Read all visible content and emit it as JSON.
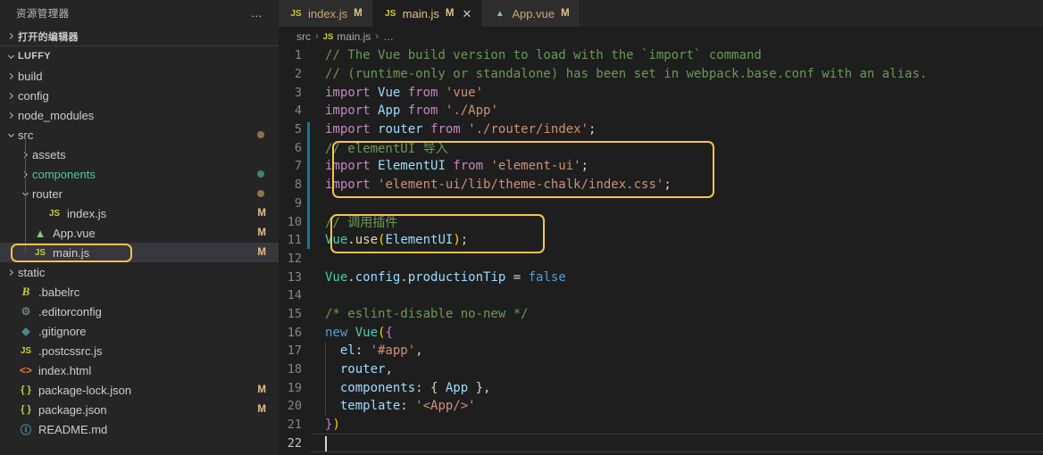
{
  "sidebar": {
    "header_title": "资源管理器",
    "more_icon": "…",
    "open_editors_label": "打开的编辑器",
    "project_label": "LUFFY",
    "tree": [
      {
        "name": "build",
        "kind": "folder",
        "icon": "chevron-right-icon",
        "indent": 1,
        "badge": "",
        "dot": "",
        "color": ""
      },
      {
        "name": "config",
        "kind": "folder",
        "icon": "chevron-right-icon",
        "indent": 1,
        "badge": "",
        "dot": "",
        "color": ""
      },
      {
        "name": "node_modules",
        "kind": "folder",
        "icon": "chevron-right-icon",
        "indent": 1,
        "badge": "",
        "dot": "",
        "color": ""
      },
      {
        "name": "src",
        "kind": "folder",
        "icon": "chevron-down-icon",
        "indent": 1,
        "badge": "",
        "dot": "#8c7349",
        "color": ""
      },
      {
        "name": "assets",
        "kind": "folder",
        "icon": "chevron-right-icon",
        "indent": 2,
        "badge": "",
        "dot": "",
        "color": ""
      },
      {
        "name": "components",
        "kind": "folder",
        "icon": "chevron-right-icon",
        "indent": 2,
        "badge": "",
        "dot": "#3a8a63",
        "color": "green"
      },
      {
        "name": "router",
        "kind": "folder",
        "icon": "chevron-down-icon",
        "indent": 2,
        "badge": "",
        "dot": "#8c7349",
        "color": ""
      },
      {
        "name": "index.js",
        "kind": "js",
        "icon": "js-file-icon",
        "indent": 3,
        "badge": "M",
        "dot": "",
        "color": ""
      },
      {
        "name": "App.vue",
        "kind": "vue",
        "icon": "vue-file-icon",
        "indent": 2,
        "badge": "M",
        "dot": "",
        "color": ""
      },
      {
        "name": "main.js",
        "kind": "js",
        "icon": "js-file-icon",
        "indent": 2,
        "badge": "M",
        "dot": "",
        "color": "",
        "selected": true,
        "annotated": true
      },
      {
        "name": "static",
        "kind": "folder",
        "icon": "chevron-right-icon",
        "indent": 1,
        "badge": "",
        "dot": "",
        "color": ""
      },
      {
        "name": ".babelrc",
        "kind": "babel",
        "icon": "babel-file-icon",
        "indent": 1,
        "badge": "",
        "dot": "",
        "color": ""
      },
      {
        "name": ".editorconfig",
        "kind": "gear",
        "icon": "gear-file-icon",
        "indent": 1,
        "badge": "",
        "dot": "",
        "color": ""
      },
      {
        "name": ".gitignore",
        "kind": "git",
        "icon": "git-file-icon",
        "indent": 1,
        "badge": "",
        "dot": "",
        "color": ""
      },
      {
        "name": ".postcssrc.js",
        "kind": "js",
        "icon": "js-file-icon",
        "indent": 1,
        "badge": "",
        "dot": "",
        "color": ""
      },
      {
        "name": "index.html",
        "kind": "html",
        "icon": "html-file-icon",
        "indent": 1,
        "badge": "",
        "dot": "",
        "color": ""
      },
      {
        "name": "package-lock.json",
        "kind": "json",
        "icon": "json-file-icon",
        "indent": 1,
        "badge": "M",
        "dot": "",
        "color": ""
      },
      {
        "name": "package.json",
        "kind": "json",
        "icon": "json-file-icon",
        "indent": 1,
        "badge": "M",
        "dot": "",
        "color": ""
      },
      {
        "name": "README.md",
        "kind": "md",
        "icon": "info-file-icon",
        "indent": 1,
        "badge": "",
        "dot": "",
        "color": ""
      }
    ]
  },
  "tabs": [
    {
      "icon": "js-file-icon",
      "name": "index.js",
      "dirty": "M",
      "active": false,
      "closable": false
    },
    {
      "icon": "js-file-icon",
      "name": "main.js",
      "dirty": "M",
      "active": true,
      "closable": true,
      "close_icon": "close-icon"
    },
    {
      "icon": "vue-file-icon",
      "name": "App.vue",
      "dirty": "M",
      "active": false,
      "closable": false
    }
  ],
  "breadcrumb": {
    "root": "src",
    "file": "main.js",
    "trailing": "…",
    "sep": "›"
  },
  "editor": {
    "file_icon": "js-file-icon",
    "cursor_line": 22,
    "lines": [
      {
        "n": 1,
        "tokens": [
          {
            "t": "// The Vue build version to load with the `import` command",
            "c": "t-comment"
          }
        ]
      },
      {
        "n": 2,
        "tokens": [
          {
            "t": "// (runtime-only or standalone) has been set in webpack.base.conf with an alias.",
            "c": "t-comment"
          }
        ]
      },
      {
        "n": 3,
        "tokens": [
          {
            "t": "import ",
            "c": "t-keyword"
          },
          {
            "t": "Vue",
            "c": "t-ident"
          },
          {
            "t": " from ",
            "c": "t-keyword"
          },
          {
            "t": "'vue'",
            "c": "t-string"
          }
        ]
      },
      {
        "n": 4,
        "tokens": [
          {
            "t": "import ",
            "c": "t-keyword"
          },
          {
            "t": "App",
            "c": "t-ident"
          },
          {
            "t": " from ",
            "c": "t-keyword"
          },
          {
            "t": "'./App'",
            "c": "t-string"
          }
        ]
      },
      {
        "n": 5,
        "tokens": [
          {
            "t": "import ",
            "c": "t-keyword"
          },
          {
            "t": "router",
            "c": "t-ident"
          },
          {
            "t": " from ",
            "c": "t-keyword"
          },
          {
            "t": "'./router/index'",
            "c": "t-string"
          },
          {
            "t": ";",
            "c": "t-punc"
          }
        ]
      },
      {
        "n": 6,
        "tokens": [
          {
            "t": "// elementUI 导入",
            "c": "t-comment"
          }
        ]
      },
      {
        "n": 7,
        "tokens": [
          {
            "t": "import ",
            "c": "t-keyword"
          },
          {
            "t": "ElementUI",
            "c": "t-ident"
          },
          {
            "t": " from ",
            "c": "t-keyword"
          },
          {
            "t": "'element-ui'",
            "c": "t-string"
          },
          {
            "t": ";",
            "c": "t-punc"
          }
        ]
      },
      {
        "n": 8,
        "tokens": [
          {
            "t": "import ",
            "c": "t-keyword"
          },
          {
            "t": "'element-ui/lib/theme-chalk/index.css'",
            "c": "t-string"
          },
          {
            "t": ";",
            "c": "t-punc"
          }
        ]
      },
      {
        "n": 9,
        "tokens": []
      },
      {
        "n": 10,
        "tokens": [
          {
            "t": "// 调用插件",
            "c": "t-comment"
          }
        ]
      },
      {
        "n": 11,
        "tokens": [
          {
            "t": "Vue",
            "c": "t-class"
          },
          {
            "t": ".",
            "c": "t-punc"
          },
          {
            "t": "use",
            "c": "t-yellow"
          },
          {
            "t": "(",
            "c": "t-brace2"
          },
          {
            "t": "ElementUI",
            "c": "t-ident"
          },
          {
            "t": ")",
            "c": "t-brace2"
          },
          {
            "t": ";",
            "c": "t-punc"
          }
        ]
      },
      {
        "n": 12,
        "tokens": []
      },
      {
        "n": 13,
        "tokens": [
          {
            "t": "Vue",
            "c": "t-class"
          },
          {
            "t": ".",
            "c": "t-punc"
          },
          {
            "t": "config",
            "c": "t-prop"
          },
          {
            "t": ".",
            "c": "t-punc"
          },
          {
            "t": "productionTip",
            "c": "t-prop"
          },
          {
            "t": " = ",
            "c": "t-punc"
          },
          {
            "t": "false",
            "c": "t-blue"
          }
        ]
      },
      {
        "n": 14,
        "tokens": []
      },
      {
        "n": 15,
        "tokens": [
          {
            "t": "/* eslint-disable no-new */",
            "c": "t-comment"
          }
        ]
      },
      {
        "n": 16,
        "tokens": [
          {
            "t": "new ",
            "c": "t-blue"
          },
          {
            "t": "Vue",
            "c": "t-class"
          },
          {
            "t": "(",
            "c": "t-brace2"
          },
          {
            "t": "{",
            "c": "t-brace1"
          }
        ]
      },
      {
        "n": 17,
        "tokens": [
          {
            "t": "  ",
            "c": "t-punc"
          },
          {
            "t": "el",
            "c": "t-prop"
          },
          {
            "t": ": ",
            "c": "t-punc"
          },
          {
            "t": "'#app'",
            "c": "t-string"
          },
          {
            "t": ",",
            "c": "t-punc"
          }
        ]
      },
      {
        "n": 18,
        "tokens": [
          {
            "t": "  ",
            "c": "t-punc"
          },
          {
            "t": "router",
            "c": "t-prop"
          },
          {
            "t": ",",
            "c": "t-punc"
          }
        ]
      },
      {
        "n": 19,
        "tokens": [
          {
            "t": "  ",
            "c": "t-punc"
          },
          {
            "t": "components",
            "c": "t-prop"
          },
          {
            "t": ": ",
            "c": "t-punc"
          },
          {
            "t": "{",
            "c": "t-punc"
          },
          {
            "t": " App ",
            "c": "t-ident"
          },
          {
            "t": "}",
            "c": "t-punc"
          },
          {
            "t": ",",
            "c": "t-punc"
          }
        ]
      },
      {
        "n": 20,
        "tokens": [
          {
            "t": "  ",
            "c": "t-punc"
          },
          {
            "t": "template",
            "c": "t-prop"
          },
          {
            "t": ": ",
            "c": "t-punc"
          },
          {
            "t": "'<App/>'",
            "c": "t-string"
          }
        ]
      },
      {
        "n": 21,
        "tokens": [
          {
            "t": "}",
            "c": "t-brace1"
          },
          {
            "t": ")",
            "c": "t-brace2"
          }
        ]
      },
      {
        "n": 22,
        "tokens": []
      }
    ],
    "annotation_boxes": [
      {
        "from_line": 6,
        "to_line": 8,
        "label": "elementui-import-highlight"
      },
      {
        "from_line": 10,
        "to_line": 11,
        "label": "elementui-use-highlight"
      }
    ]
  },
  "colors": {
    "annotation": "#f5c44a",
    "sidebar_bg": "#252526",
    "editor_bg": "#1e1e1e",
    "modified_badge": "#e2c08d",
    "git_change_bar": "#0c7d9d"
  }
}
